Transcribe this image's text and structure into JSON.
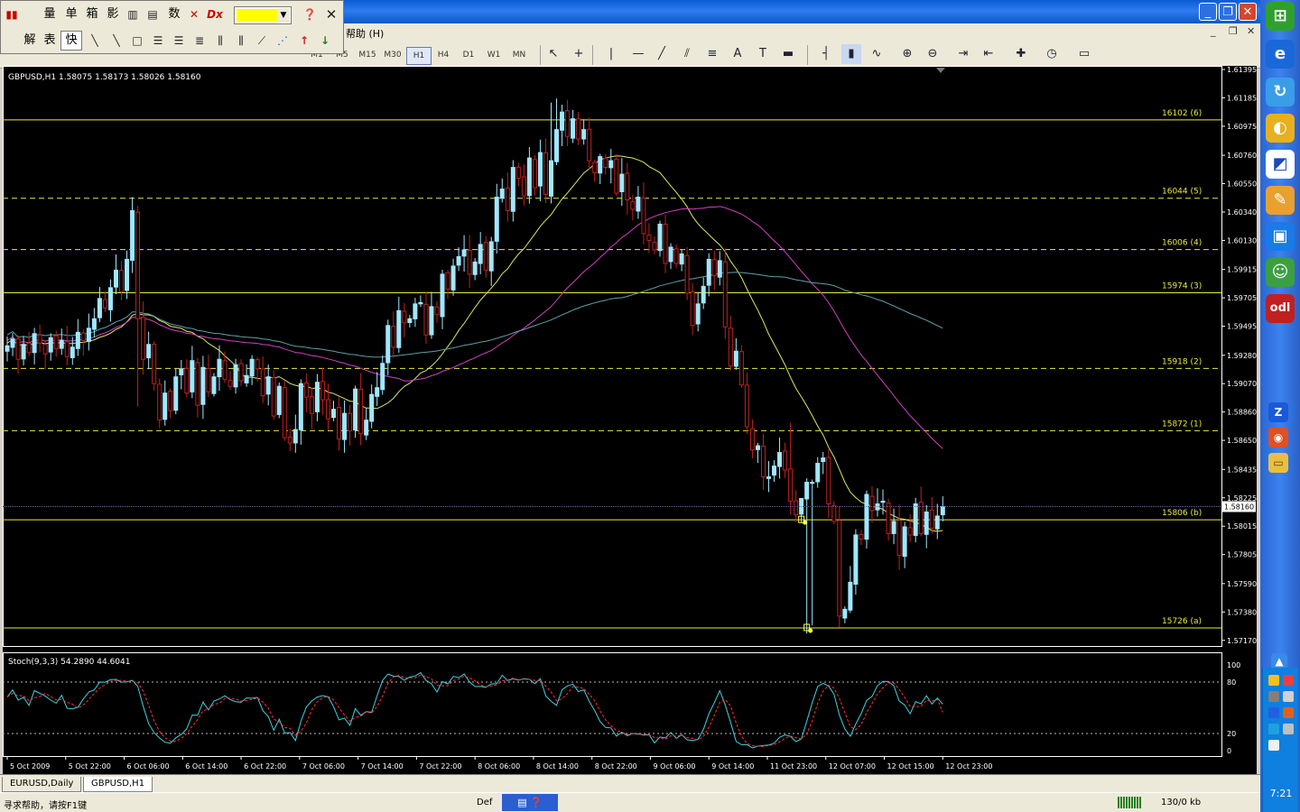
{
  "toolbar_float": {
    "row1_labels": [
      "量",
      "单",
      "箱",
      "影",
      "数"
    ],
    "row2_labels": [
      "解",
      "表",
      "快"
    ],
    "color_hex": "#ffff00"
  },
  "menu": {
    "help_label": "帮助 (H)"
  },
  "toolbar": {
    "periods": [
      "M1",
      "M5",
      "M15",
      "M30",
      "H1",
      "H4",
      "D1",
      "W1",
      "MN"
    ],
    "active_period": "H1",
    "overlay_text": "?????????"
  },
  "window_controls": {
    "minimize": "_",
    "restore": "❐",
    "close": "✕"
  },
  "mdi_controls": {
    "minimize": "_",
    "restore": "❐",
    "close": "✕"
  },
  "chart_data": {
    "type": "candlestick",
    "header": "GBPUSD,H1  1.58075 1.58173 1.58026 1.58160",
    "symbol": "GBPUSD,H1",
    "current_price_label": "1.58160",
    "current_price": 1.5816,
    "ylim": [
      1.57155,
      1.61395
    ],
    "y_ticks": [
      "1.61395",
      "1.61185",
      "1.60975",
      "1.60760",
      "1.60550",
      "1.60340",
      "1.60130",
      "1.59915",
      "1.59705",
      "1.59495",
      "1.59280",
      "1.59070",
      "1.58860",
      "1.58650",
      "1.58435",
      "1.58225",
      "1.58015",
      "1.57805",
      "1.57590",
      "1.57380",
      "1.57170"
    ],
    "x_ticks": [
      "5 Oct 2009",
      "5 Oct 22:00",
      "6 Oct 06:00",
      "6 Oct 14:00",
      "6 Oct 22:00",
      "7 Oct 06:00",
      "7 Oct 14:00",
      "7 Oct 22:00",
      "8 Oct 06:00",
      "8 Oct 14:00",
      "8 Oct 22:00",
      "9 Oct 06:00",
      "9 Oct 14:00",
      "11 Oct 23:00",
      "12 Oct 07:00",
      "12 Oct 15:00",
      "12 Oct 23:00"
    ],
    "fib_levels": [
      {
        "label": "16102 (6)",
        "value": 1.61022,
        "style": "solid"
      },
      {
        "label": "16044 (5)",
        "value": 1.60442,
        "style": "dashed"
      },
      {
        "label": "16006 (4)",
        "value": 1.60062,
        "style": "dashed"
      },
      {
        "label": "15974 (3)",
        "value": 1.59742,
        "style": "solid"
      },
      {
        "label": "15918 (2)",
        "value": 1.59182,
        "style": "dashed"
      },
      {
        "label": "15872 (1)",
        "value": 1.58722,
        "style": "dashed"
      },
      {
        "label": "15806 (b)",
        "value": 1.58062,
        "style": "solid"
      },
      {
        "label": "15726 (a)",
        "value": 1.57262,
        "style": "solid"
      }
    ],
    "candle_count": 171,
    "closes": [
      1.5935,
      1.594,
      1.5925,
      1.5936,
      1.593,
      1.5944,
      1.5937,
      1.5929,
      1.5941,
      1.5933,
      1.5939,
      1.5927,
      1.5934,
      1.5945,
      1.5939,
      1.5948,
      1.5955,
      1.597,
      1.5963,
      1.5978,
      1.5991,
      1.5975,
      1.5999,
      1.6035,
      1.5955,
      1.5925,
      1.5936,
      1.5907,
      1.588,
      1.59,
      1.5887,
      1.5912,
      1.5918,
      1.59,
      1.5924,
      1.5891,
      1.5919,
      1.5901,
      1.5912,
      1.5925,
      1.591,
      1.5905,
      1.5921,
      1.5909,
      1.5913,
      1.5925,
      1.5918,
      1.5898,
      1.5912,
      1.5883,
      1.5905,
      1.5867,
      1.5863,
      1.5873,
      1.5907,
      1.5897,
      1.5885,
      1.5908,
      1.5895,
      1.5881,
      1.5888,
      1.5866,
      1.5885,
      1.5872,
      1.5903,
      1.587,
      1.588,
      1.5899,
      1.5904,
      1.5922,
      1.595,
      1.5934,
      1.5961,
      1.5952,
      1.5955,
      1.5966,
      1.5967,
      1.5943,
      1.5964,
      1.5958,
      1.5988,
      1.5977,
      1.5994,
      1.6001,
      1.6006,
      1.5988,
      1.5997,
      1.601,
      1.5991,
      1.6012,
      1.6045,
      1.6051,
      1.6035,
      1.6067,
      1.6059,
      1.6046,
      1.6074,
      1.6052,
      1.6078,
      1.6047,
      1.6072,
      1.6095,
      1.6108,
      1.609,
      1.6103,
      1.6088,
      1.6095,
      1.6072,
      1.6063,
      1.6075,
      1.6067,
      1.6072,
      1.6048,
      1.6062,
      1.6043,
      1.6036,
      1.6045,
      1.6018,
      1.6013,
      1.6006,
      1.6025,
      1.5996,
      1.6008,
      1.5996,
      1.6003,
      1.5974,
      1.595,
      1.5966,
      1.5979,
      1.5999,
      1.5987,
      1.5998,
      1.5949,
      1.592,
      1.5931,
      1.5906,
      1.5875,
      1.5858,
      1.5861,
      1.5838,
      1.5838,
      1.5846,
      1.5856,
      1.5843,
      1.582,
      1.581,
      1.5822,
      1.5834,
      1.5834,
      1.5848,
      1.5852,
      1.5818,
      1.5805,
      1.5735,
      1.574,
      1.576,
      1.5795,
      1.5792,
      1.5825,
      1.5813,
      1.5818,
      1.582,
      1.5796,
      1.5805,
      1.578,
      1.5801,
      1.5795,
      1.5818,
      1.5796,
      1.5812,
      1.58,
      1.5809,
      1.5816
    ],
    "moving_averages": [
      {
        "name": "fast",
        "color": "#d8e860"
      },
      {
        "name": "medium",
        "color": "#d040c0"
      },
      {
        "name": "slow",
        "color": "#5fa0a8"
      }
    ],
    "up_color": "#a0e8ff",
    "down_color": "#c02020",
    "indicator": {
      "header": "Stoch(9,3,3) 54.2890 44.6041",
      "name": "Stoch(9,3,3)",
      "main": 54.289,
      "signal": 44.6041,
      "ylim": [
        0,
        100
      ],
      "y_ticks": [
        "100",
        "80",
        "20",
        "0"
      ],
      "levels": [
        80,
        20
      ],
      "main_color": "#40d0e0",
      "signal_color": "#ff3030"
    }
  },
  "tabs": [
    "EURUSD,Daily",
    "GBPUSD,H1"
  ],
  "active_tab": "GBPUSD,H1",
  "status": {
    "help_text": "寻求帮助，请按F1键",
    "profile": "Def",
    "traffic": "130/0 kb"
  },
  "tray": {
    "clock": "7:21"
  }
}
